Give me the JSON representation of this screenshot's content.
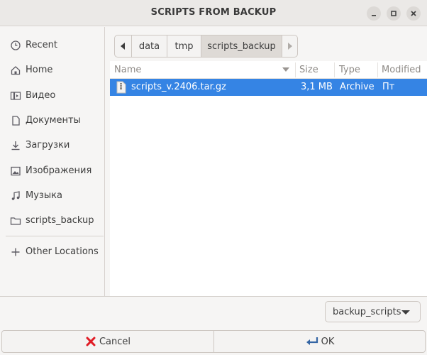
{
  "window": {
    "title": "SCRIPTS FROM BACKUP"
  },
  "sidebar": {
    "items": [
      {
        "label": "Recent",
        "icon": "clock-icon"
      },
      {
        "label": "Home",
        "icon": "home-icon"
      },
      {
        "label": "Видео",
        "icon": "video-icon"
      },
      {
        "label": "Документы",
        "icon": "document-icon"
      },
      {
        "label": "Загрузки",
        "icon": "download-icon"
      },
      {
        "label": "Изображения",
        "icon": "image-icon"
      },
      {
        "label": "Музыка",
        "icon": "music-icon"
      },
      {
        "label": "scripts_backup",
        "icon": "folder-icon"
      },
      {
        "label": "Other Locations",
        "icon": "plus-icon"
      }
    ]
  },
  "pathbar": {
    "segments": [
      "data",
      "tmp",
      "scripts_backup"
    ],
    "active": "scripts_backup"
  },
  "columns": {
    "name": "Name",
    "size": "Size",
    "type": "Type",
    "modified": "Modified"
  },
  "files": [
    {
      "name": "scripts_v.2406.tar.gz",
      "size": "3,1 MB",
      "type": "Archive",
      "modified": "Пт",
      "selected": true
    }
  ],
  "filter": {
    "selected": "backup_scripts"
  },
  "buttons": {
    "cancel": "Cancel",
    "ok": "OK"
  },
  "colors": {
    "selection": "#3584e4",
    "cancel_icon": "#e01b24",
    "ok_icon": "#3465a4"
  }
}
